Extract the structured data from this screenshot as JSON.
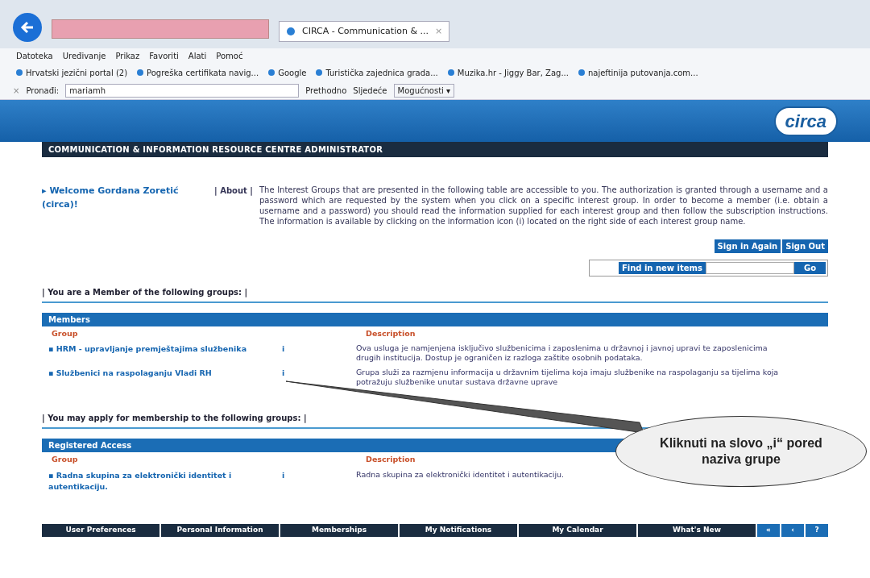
{
  "browser": {
    "tab_title": "CIRCA - Communication & ...",
    "tab_close": "×",
    "menu": [
      "Datoteka",
      "Uređivanje",
      "Prikaz",
      "Favoriti",
      "Alati",
      "Pomoć"
    ],
    "favorites": [
      {
        "label": "Hrvatski jezični portal (2)"
      },
      {
        "label": "Pogreška certifikata navig..."
      },
      {
        "label": "Google"
      },
      {
        "label": "Turistička zajednica grada..."
      },
      {
        "label": "Muzika.hr - Jiggy Bar, Zag..."
      },
      {
        "label": "najeftinija putovanja.com..."
      }
    ],
    "find_bar": {
      "close": "×",
      "label": "Pronađi:",
      "value": "mariamh",
      "previous": "Prethodno",
      "next": "Sljedeće",
      "options": "Mogućnosti ▾"
    }
  },
  "page": {
    "logo": "circa",
    "title": "COMMUNICATION & INFORMATION RESOURCE CENTRE ADMINISTRATOR",
    "welcome_marker": "▸",
    "welcome": "Welcome Gordana Zoretić (circa)!",
    "bracket": "|",
    "bullet": "▪",
    "about_label": "About",
    "about_text": "The Interest Groups that are presented in the following table are accessible to you. The authorization is granted through a username and a password which are requested by the system when you click on a specific interest group. In order to become a member (i.e. obtain a username and a password) you should read the information supplied for each interest group and then follow the subscription instructions. The information is available by clicking on the information icon (i) located on the right side of each interest group name.",
    "buttons": [
      "Sign in Again",
      "Sign Out"
    ],
    "find_new": {
      "label": "Find in new items",
      "go": "Go"
    },
    "sections": [
      {
        "heading": "You are a Member of the following groups:",
        "bar": "Members",
        "columns": [
          "Group",
          "Description"
        ],
        "rows": [
          {
            "group": "HRM - upravljanje premještajima službenika",
            "info": "i",
            "description": "Ova usluga je namjenjena isključivo službenicima i zaposlenima u državnoj i javnoj upravi te zaposlenicima drugih institucija. Dostup je ograničen iz razloga zaštite osobnih podataka."
          },
          {
            "group": "Službenici na raspolaganju Vladi RH",
            "info": "i",
            "description": "Grupa služi za razmjenu informacija u državnim tijelima koja imaju službenike na raspolaganju sa tijelima koja potražuju službenike unutar sustava državne uprave"
          }
        ]
      },
      {
        "heading": "You may apply for membership to the following groups:",
        "bar": "Registered Access",
        "columns": [
          "Group",
          "Description"
        ],
        "rows": [
          {
            "group": "Radna skupina za elektronički identitet i autentikaciju.",
            "info": "i",
            "description": "Radna skupina za elektronički identitet i autentikaciju."
          }
        ]
      }
    ],
    "nav": [
      "User Preferences",
      "Personal Information",
      "Memberships",
      "My Notifications",
      "My Calendar",
      "What's New"
    ],
    "nav_small": [
      "«",
      "‹",
      "?"
    ],
    "callout": "Kliknuti na slovo „i“ pored naziva grupe"
  }
}
